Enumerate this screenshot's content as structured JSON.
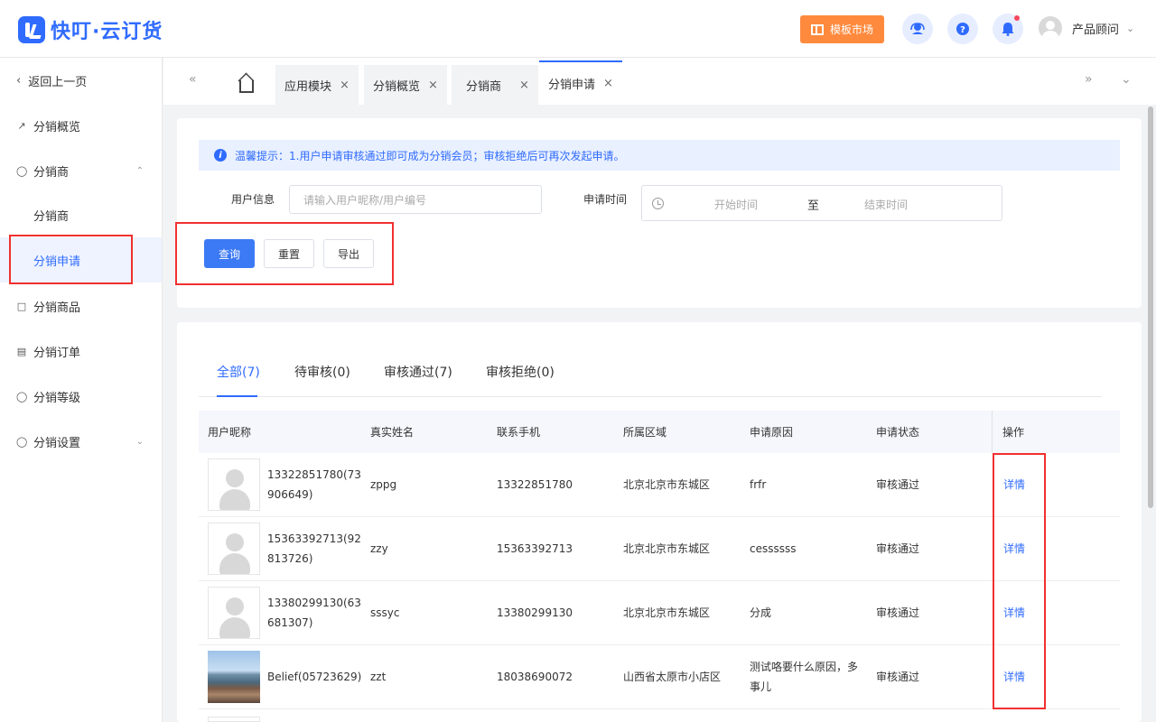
{
  "header": {
    "logo_text": "快叮·云订货",
    "market_label": "模板市场",
    "user_name": "产品顾问",
    "icons": [
      "service-icon",
      "help-icon",
      "bell-icon"
    ]
  },
  "sidebar": {
    "back_label": "返回上一页",
    "items": [
      {
        "label": "分销概览",
        "icon": "chart-icon"
      },
      {
        "label": "分销商",
        "icon": "users-icon",
        "expanded": true
      },
      {
        "label": "分销商",
        "sub": true
      },
      {
        "label": "分销申请",
        "sub": true,
        "active": true
      },
      {
        "label": "分销商品",
        "icon": "box-icon"
      },
      {
        "label": "分销订单",
        "icon": "order-icon"
      },
      {
        "label": "分销等级",
        "icon": "level-icon"
      },
      {
        "label": "分销设置",
        "icon": "settings-icon",
        "expanded": false
      }
    ]
  },
  "tabs": [
    {
      "label": "应用模块"
    },
    {
      "label": "分销概览"
    },
    {
      "label": "分销商"
    },
    {
      "label": "分销申请",
      "active": true
    }
  ],
  "notice": "温馨提示：1.用户申请审核通过即可成为分销会员；审核拒绝后可再次发起申请。",
  "filters": {
    "user_label": "用户信息",
    "user_placeholder": "请输入用户昵称/用户编号",
    "time_label": "申请时间",
    "start_placeholder": "开始时间",
    "separator": "至",
    "end_placeholder": "结束时间"
  },
  "buttons": {
    "query": "查询",
    "reset": "重置",
    "export": "导出"
  },
  "status_tabs": [
    {
      "label": "全部(7)",
      "active": true
    },
    {
      "label": "待审核(0)"
    },
    {
      "label": "审核通过(7)"
    },
    {
      "label": "审核拒绝(0)"
    }
  ],
  "table": {
    "columns": [
      "用户昵称",
      "真实姓名",
      "联系手机",
      "所属区域",
      "申请原因",
      "申请状态",
      "操作"
    ],
    "rows": [
      {
        "nickname_1": "13322851780(73",
        "nickname_2": "906649)",
        "real_name": "zppg",
        "phone": "13322851780",
        "region": "北京北京市东城区",
        "reason_1": "frfr",
        "reason_2": "",
        "status": "审核通过",
        "action": "详情",
        "photo": false
      },
      {
        "nickname_1": "15363392713(92",
        "nickname_2": "813726)",
        "real_name": "zzy",
        "phone": "15363392713",
        "region": "北京北京市东城区",
        "reason_1": "cessssss",
        "reason_2": "",
        "status": "审核通过",
        "action": "详情",
        "photo": false
      },
      {
        "nickname_1": "13380299130(63",
        "nickname_2": "681307)",
        "real_name": "sssyc",
        "phone": "13380299130",
        "region": "北京北京市东城区",
        "reason_1": "分成",
        "reason_2": "",
        "status": "审核通过",
        "action": "详情",
        "photo": false
      },
      {
        "nickname_1": "Belief(05723629)",
        "nickname_2": "",
        "real_name": "zzt",
        "phone": "18038690072",
        "region": "山西省太原市小店区",
        "reason_1": "测试咯要什么原因，多",
        "reason_2": "事儿",
        "status": "审核通过",
        "action": "详情",
        "photo": true
      }
    ]
  },
  "colors": {
    "accent": "#2f6bff",
    "highlight_border": "#f23030",
    "market": "#ff8a3d"
  }
}
